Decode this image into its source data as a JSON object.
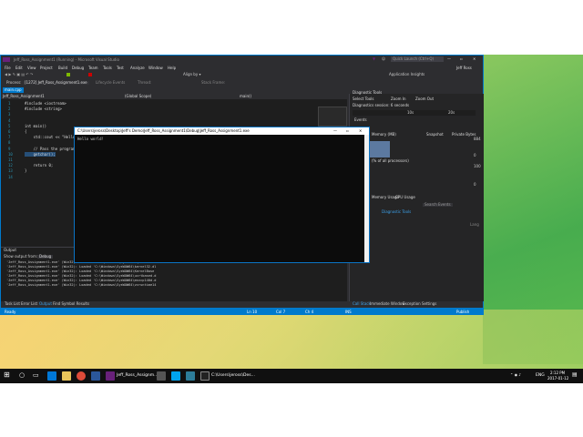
{
  "vs": {
    "window_title": "Jeff_Ross_Assignment1 (Running) - Microsoft Visual Studio",
    "quick_launch": "Quick Launch (Ctrl+Q)",
    "user": "Jeff Ross",
    "menu": [
      "File",
      "Edit",
      "View",
      "Project",
      "Build",
      "Debug",
      "Team",
      "Tools",
      "Test",
      "Analyze",
      "Window",
      "Help"
    ],
    "process_label": "Process:",
    "process_value": "[1272] Jeff_Ross_Assignment1.exe",
    "lifecycle": "Lifecycle Events",
    "thread": "Thread:",
    "stack_frame": "Stack Frame:",
    "app_insights": "Application Insights",
    "doc_tab": "main.cpp",
    "scope_left": "Jeff_Ross_Assignment1",
    "scope_mid": "(Global Scope)",
    "scope_right": "main()",
    "code_lines": [
      {
        "n": "1",
        "text": "#include <iostream>"
      },
      {
        "n": "2",
        "text": "#include <string>"
      },
      {
        "n": "3",
        "text": ""
      },
      {
        "n": "4",
        "text": ""
      },
      {
        "n": "5",
        "text": "int main()"
      },
      {
        "n": "6",
        "text": "{"
      },
      {
        "n": "7",
        "text": "    std::cout << \"Hello"
      },
      {
        "n": "8",
        "text": ""
      },
      {
        "n": "9",
        "text": "    // Pass the program"
      },
      {
        "n": "10",
        "text": "    getchar();"
      },
      {
        "n": "11",
        "text": ""
      },
      {
        "n": "12",
        "text": "    return 0;"
      },
      {
        "n": "13",
        "text": "}"
      },
      {
        "n": "14",
        "text": ""
      }
    ],
    "zoom": "98 %",
    "output_title": "Output",
    "output_show_from": "Show output from:",
    "output_source": "Debug",
    "output_lines": [
      "'Jeff_Ross_Assignment1.exe' (Win32): Unloaded 'C:\\Windows\\SysWOW64\\kernel32.",
      "'Jeff_Ross_Assignment1.exe' (Win32): Loaded 'C:\\Windows\\SysWOW64\\kernel32.dl",
      "'Jeff_Ross_Assignment1.exe' (Win32): Loaded 'C:\\Windows\\SysWOW64\\KernelBase",
      "'Jeff_Ross_Assignment1.exe' (Win32): Loaded 'C:\\Windows\\SysWOW64\\ucrtbased.d",
      "'Jeff_Ross_Assignment1.exe' (Win32): Loaded 'C:\\Windows\\SysWOW64\\msvcp140d.d",
      "'Jeff_Ross_Assignment1.exe' (Win32): Loaded 'C:\\Windows\\SysWOW64\\vcruntime14"
    ],
    "bottom_tabs": [
      "Task List",
      "Error List",
      "Output",
      "Find Symbol Results"
    ],
    "diag_title": "Diagnostic Tools",
    "select_tools": "Select Tools",
    "zoom_in": "Zoom In",
    "zoom_out": "Zoom Out",
    "diag_session": "Diagnostics session: 6 seconds",
    "tick_10s": "10s",
    "tick_20s": "20s",
    "events": "Events",
    "memory": "Memory (MB)",
    "snapshot": "Snapshot",
    "private_bytes": "Private Bytes",
    "mem_max": "884",
    "mem_min": "0",
    "cpu": "(% of all processors)",
    "cpu_max": "100",
    "cpu_min": "0",
    "mem_usage": "Memory Usage",
    "cpu_usage": "CPU Usage",
    "search_events": "Search Events",
    "diag_tabs": [
      "...ints",
      "Diagnostic Tools"
    ],
    "lang": "Lang",
    "right_tabs": [
      "Call Stack",
      "Immediate Window",
      "Exception Settings"
    ],
    "status_ready": "Ready",
    "status_ln": "Ln 10",
    "status_col": "Col 7",
    "status_ch": "Ch 4",
    "status_ins": "INS",
    "status_publish": "Publish"
  },
  "console": {
    "title": "C:\\Users\\jeross\\Desktop\\Jeff's Demo\\Jeff_Ross_Assignment1\\Debug\\Jeff_Ross_Assignment1.exe",
    "output": "Hello world!"
  },
  "taskbar": {
    "vs_label": "Jeff_Ross_Assignm...",
    "console_label": "C:\\Users\\jeross\\Des...",
    "lang": "ENG",
    "time": "2:12 PM",
    "date": "2017-01-12"
  }
}
